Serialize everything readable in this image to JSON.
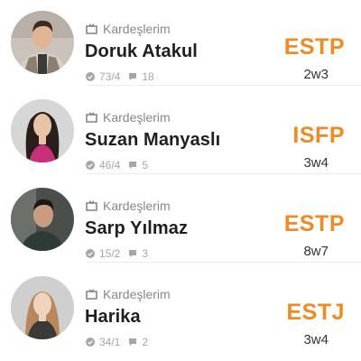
{
  "colors": {
    "accent": "#f08a24",
    "name": "#1f1f1f",
    "category": "#888888",
    "stats": "#a6a6a6"
  },
  "profiles": [
    {
      "category": "Kardeşlerim",
      "category_icon": "tv-icon",
      "name": "Doruk Atakul",
      "votes": "73/4",
      "comments": "18",
      "mbti": "ESTP",
      "enneagram": "2w3"
    },
    {
      "category": "Kardeşlerim",
      "category_icon": "tv-icon",
      "name": "Suzan Manyaslı",
      "votes": "46/4",
      "comments": "5",
      "mbti": "ISFP",
      "enneagram": "3w4"
    },
    {
      "category": "Kardeşlerim",
      "category_icon": "tv-icon",
      "name": "Sarp Yılmaz",
      "votes": "15/2",
      "comments": "3",
      "mbti": "ESTP",
      "enneagram": "8w7"
    },
    {
      "category": "Kardeşlerim",
      "category_icon": "tv-icon",
      "name": "Harika",
      "votes": "34/1",
      "comments": "2",
      "mbti": "ESTJ",
      "enneagram": "3w4"
    }
  ]
}
